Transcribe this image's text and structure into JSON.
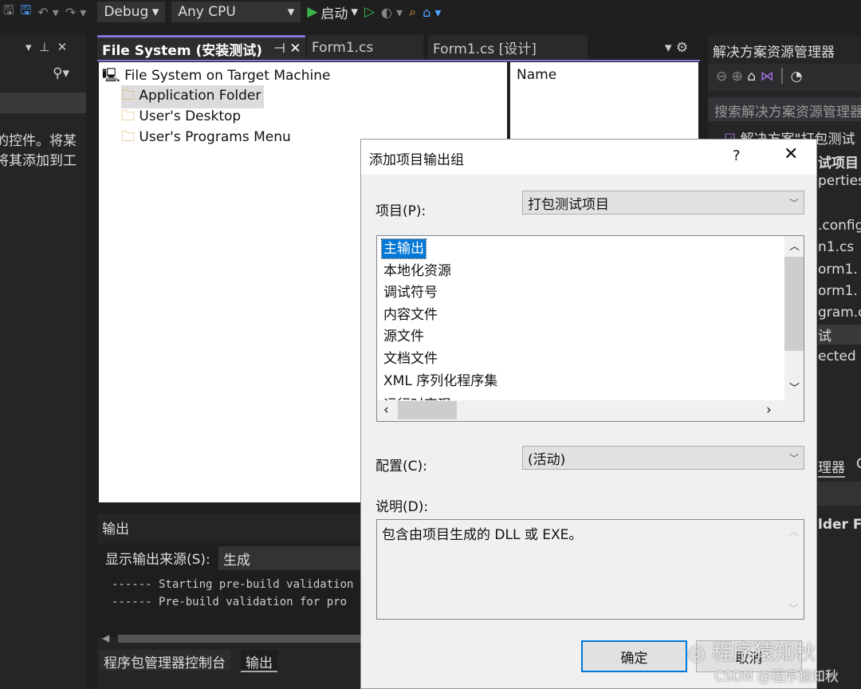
{
  "toolbar": {
    "config": "Debug",
    "platform": "Any CPU",
    "start_label": "启动"
  },
  "left_panel": {
    "text_lines": [
      "的控件。将某",
      "将其添加到工"
    ]
  },
  "doc_tabs": [
    {
      "label": "File System (安装测试)",
      "active": true
    },
    {
      "label": "Form1.cs"
    },
    {
      "label": "Form1.cs [设计]"
    }
  ],
  "tree": {
    "root": "File System on Target Machine",
    "items": [
      "Application Folder",
      "User's Desktop",
      "User's Programs Menu"
    ],
    "selected": "Application Folder"
  },
  "name_column": "Name",
  "solution_explorer": {
    "title": "解决方案资源管理器",
    "search_placeholder": "搜索解决方案资源管理器",
    "items": [
      "解决方案\"打包测试",
      "试项目",
      "perties",
      ".config",
      "n1.cs",
      "orm1.",
      "orm1.",
      "gram.c",
      "试",
      "ected D"
    ],
    "tab_fragment": "理器",
    "tab_fragment2": "C",
    "prop_fragment": "lder  F"
  },
  "output": {
    "title": "输出",
    "source_label": "显示输出来源(S):",
    "source_value": "生成",
    "lines": [
      "------ Starting pre-build validation",
      "------ Pre-build validation for pro"
    ],
    "tabs": [
      "程序包管理器控制台",
      "输出"
    ]
  },
  "dialog": {
    "title": "添加项目输出组",
    "help": "?",
    "project_label": "项目(P):",
    "project_value": "打包测试项目",
    "groups": [
      "主输出",
      "本地化资源",
      "调试符号",
      "内容文件",
      "源文件",
      "文档文件",
      "XML 序列化程序集",
      "运行时实现"
    ],
    "selected_group": "主输出",
    "config_label": "配置(C):",
    "config_value": "(活动)",
    "desc_label": "说明(D):",
    "description": "包含由项目生成的 DLL 或 EXE。",
    "ok": "确定",
    "cancel": "取消"
  },
  "watermark": {
    "text": "程序猿知秋",
    "csdn": "CSDN @程序猿知秋"
  }
}
